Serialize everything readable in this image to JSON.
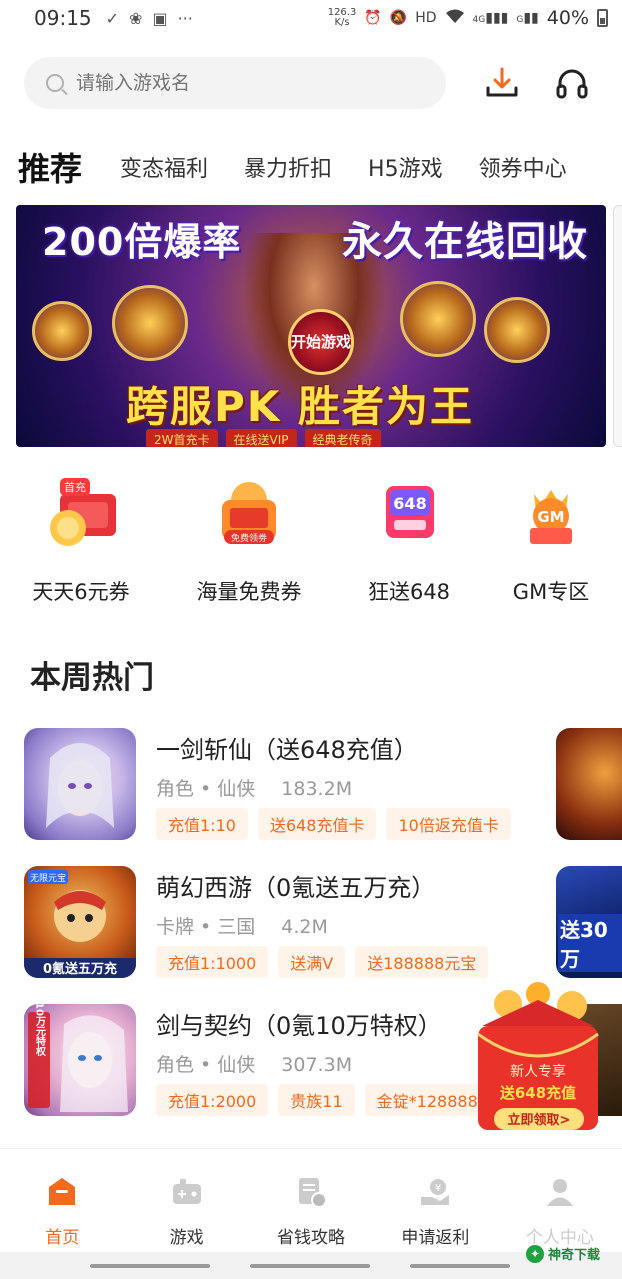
{
  "status_bar": {
    "time": "09:15",
    "net_speed_value": "126.3",
    "net_speed_unit": "K/s",
    "hd": "HD",
    "signal_4g": "4G",
    "signal_g": "G",
    "battery": "40%"
  },
  "search": {
    "placeholder": "请输入游戏名"
  },
  "tabs": [
    {
      "label": "推荐"
    },
    {
      "label": "变态福利"
    },
    {
      "label": "暴力折扣"
    },
    {
      "label": "H5游戏"
    },
    {
      "label": "领券中心"
    }
  ],
  "banner": {
    "title_left": "200倍爆率",
    "title_right": "永久在线回收",
    "start_label": "开始游戏",
    "slogan": "跨服PK 胜者为王",
    "strip": [
      "2W首充卡",
      "在线送VIP",
      "经典老传奇"
    ]
  },
  "quick_entries": [
    {
      "label": "天天6元券",
      "badge": "首充"
    },
    {
      "label": "海量免费券",
      "badge": "免费领劵"
    },
    {
      "label": "狂送648",
      "badge": "648"
    },
    {
      "label": "GM专区",
      "badge": "GM"
    }
  ],
  "section": {
    "title": "本周热门"
  },
  "games": [
    {
      "name": "一剑斩仙（送648充值）",
      "genre": "角色 • 仙侠",
      "size": "183.2M",
      "tags": [
        "充值1:10",
        "送648充值卡",
        "10倍返充值卡"
      ]
    },
    {
      "name": "萌幻西游（0氪送五万充）",
      "genre": "卡牌 • 三国",
      "size": "4.2M",
      "tags": [
        "充值1:1000",
        "送满V",
        "送188888元宝"
      ],
      "icon_text": "0氪送五万充",
      "icon_badge": "无限元宝"
    },
    {
      "name": "剑与契约（0氪10万特权）",
      "genre": "角色 • 仙侠",
      "size": "307.3M",
      "tags": [
        "充值1:2000",
        "贵族11",
        "金锭*128888"
      ],
      "icon_text": "送10万元特权"
    }
  ],
  "peek_cards": [
    {
      "text": ""
    },
    {
      "text": "送30万"
    },
    {
      "text": ""
    }
  ],
  "promo": {
    "line1": "新人专享",
    "line2": "送648充值",
    "button": "立即领取>"
  },
  "bottom_nav": [
    {
      "label": "首页",
      "active": true
    },
    {
      "label": "游戏",
      "active": false
    },
    {
      "label": "省钱攻略",
      "active": false
    },
    {
      "label": "申请返利",
      "active": false
    },
    {
      "label": "个人中心",
      "active": false
    }
  ],
  "watermark": {
    "text": "神奇下载"
  },
  "colors": {
    "accent": "#f36a1f",
    "tag_bg": "#fff3ea",
    "search_bg": "#f3f3f3"
  }
}
